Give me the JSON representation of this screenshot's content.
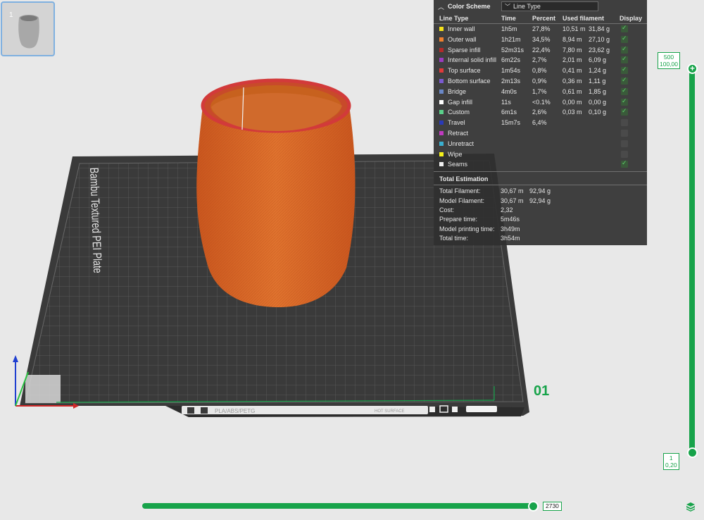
{
  "thumbnail": {
    "index": "1"
  },
  "plate": {
    "brand_text": "Bambu Textured PEI Plate",
    "plate_number": "01",
    "filament_label": "PLA/ABS/PETG",
    "surface_label": "HOT SURFACE"
  },
  "color_scheme": {
    "title": "Color Scheme",
    "selected": "Line Type",
    "columns": [
      "Line Type",
      "Time",
      "Percent",
      "Used filament",
      "Display"
    ],
    "rows": [
      {
        "name": "Inner wall",
        "color": "#f5e21a",
        "time": "1h5m",
        "percent": "27,8%",
        "length": "10,51 m",
        "weight": "31,84 g",
        "display": true
      },
      {
        "name": "Outer wall",
        "color": "#f0802e",
        "time": "1h21m",
        "percent": "34,5%",
        "length": "8,94 m",
        "weight": "27,10 g",
        "display": true
      },
      {
        "name": "Sparse infill",
        "color": "#b22a2a",
        "time": "52m31s",
        "percent": "22,4%",
        "length": "7,80 m",
        "weight": "23,62 g",
        "display": true
      },
      {
        "name": "Internal solid infill",
        "color": "#9a3cc0",
        "time": "6m22s",
        "percent": "2,7%",
        "length": "2,01 m",
        "weight": "6,09 g",
        "display": true
      },
      {
        "name": "Top surface",
        "color": "#e03a3a",
        "time": "1m54s",
        "percent": "0,8%",
        "length": "0,41 m",
        "weight": "1,24 g",
        "display": true
      },
      {
        "name": "Bottom surface",
        "color": "#7a5ad0",
        "time": "2m13s",
        "percent": "0,9%",
        "length": "0,36 m",
        "weight": "1,11 g",
        "display": true
      },
      {
        "name": "Bridge",
        "color": "#6a88c8",
        "time": "4m0s",
        "percent": "1,7%",
        "length": "0,61 m",
        "weight": "1,85 g",
        "display": true
      },
      {
        "name": "Gap infill",
        "color": "#ffffff",
        "time": "11s",
        "percent": "<0.1%",
        "length": "0,00 m",
        "weight": "0,00 g",
        "display": true
      },
      {
        "name": "Custom",
        "color": "#5ad08a",
        "time": "6m1s",
        "percent": "2,6%",
        "length": "0,03 m",
        "weight": "0,10 g",
        "display": true
      },
      {
        "name": "Travel",
        "color": "#2a3ab8",
        "time": "15m7s",
        "percent": "6,4%",
        "length": "",
        "weight": "",
        "display": false
      },
      {
        "name": "Retract",
        "color": "#c03ac0",
        "time": "",
        "percent": "",
        "length": "",
        "weight": "",
        "display": false
      },
      {
        "name": "Unretract",
        "color": "#3ab0d0",
        "time": "",
        "percent": "",
        "length": "",
        "weight": "",
        "display": false
      },
      {
        "name": "Wipe",
        "color": "#f5f01a",
        "time": "",
        "percent": "",
        "length": "",
        "weight": "",
        "display": false
      },
      {
        "name": "Seams",
        "color": "#f0f0f0",
        "time": "",
        "percent": "",
        "length": "",
        "weight": "",
        "display": true
      }
    ]
  },
  "total_estimation": {
    "title": "Total Estimation",
    "rows": [
      {
        "label": "Total Filament:",
        "value": "30,67 m",
        "extra": "92,94 g"
      },
      {
        "label": "Model Filament:",
        "value": "30,67 m",
        "extra": "92,94 g"
      },
      {
        "label": "Cost:",
        "value": "2,32",
        "extra": ""
      },
      {
        "label": "Prepare time:",
        "value": "5m46s",
        "extra": ""
      },
      {
        "label": "Model printing time:",
        "value": "3h49m",
        "extra": ""
      },
      {
        "label": "Total time:",
        "value": "3h54m",
        "extra": ""
      }
    ]
  },
  "layer_slider": {
    "top_layer": "500",
    "top_height": "100,00",
    "bottom_layer": "1",
    "bottom_height": "0,20",
    "top_knob_icon": "plus-icon"
  },
  "move_slider": {
    "value": "2730"
  },
  "colors": {
    "accent": "#17a34a",
    "model": "#d9662a",
    "bed": "#3a3a3a"
  },
  "icons": [
    "layers-icon",
    "axis-gizmo-icon",
    "collapse-chevron-icon",
    "checkbox-icon"
  ]
}
